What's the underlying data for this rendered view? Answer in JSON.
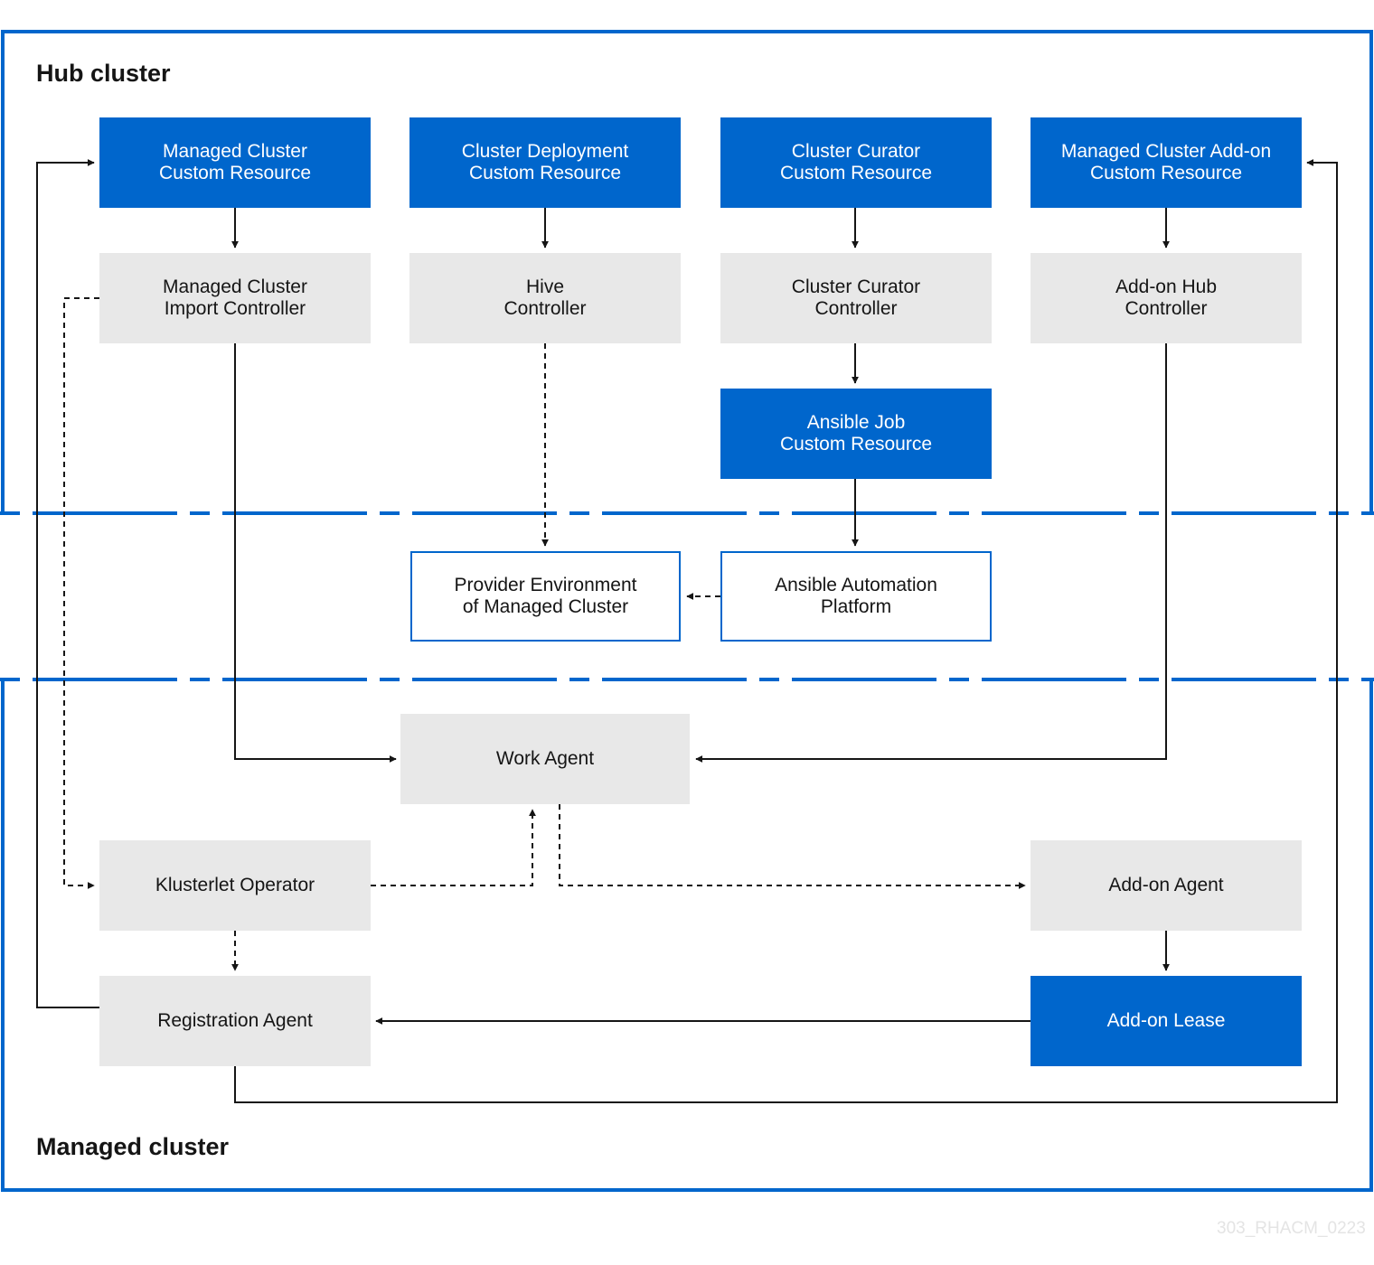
{
  "colors": {
    "accent": "#0066cc",
    "node_gray": "#e8e8e8",
    "line": "#151515",
    "watermark": "#e4e4e4"
  },
  "regions": {
    "hub": {
      "label": "Hub cluster"
    },
    "managed": {
      "label": "Managed cluster"
    }
  },
  "nodes": {
    "managed_cluster_cr": {
      "label": "Managed Cluster\nCustom Resource",
      "style": "blue"
    },
    "cluster_deployment_cr": {
      "label": "Cluster Deployment\nCustom Resource",
      "style": "blue"
    },
    "cluster_curator_cr": {
      "label": "Cluster Curator\nCustom Resource",
      "style": "blue"
    },
    "managed_cluster_addon_cr": {
      "label": "Managed Cluster Add-on\nCustom Resource",
      "style": "blue"
    },
    "import_controller": {
      "label": "Managed Cluster\nImport Controller",
      "style": "gray"
    },
    "hive_controller": {
      "label": "Hive\nController",
      "style": "gray"
    },
    "cluster_curator_controller": {
      "label": "Cluster Curator\nController",
      "style": "gray"
    },
    "addon_hub_controller": {
      "label": "Add-on Hub\nController",
      "style": "gray"
    },
    "ansible_job_cr": {
      "label": "Ansible Job\nCustom Resource",
      "style": "blue"
    },
    "provider_environment": {
      "label": "Provider Environment\nof Managed Cluster",
      "style": "outline"
    },
    "ansible_automation_platform": {
      "label": "Ansible Automation\nPlatform",
      "style": "outline"
    },
    "work_agent": {
      "label": "Work Agent",
      "style": "gray"
    },
    "klusterlet_operator": {
      "label": "Klusterlet Operator",
      "style": "gray"
    },
    "addon_agent": {
      "label": "Add-on Agent",
      "style": "gray"
    },
    "registration_agent": {
      "label": "Registration Agent",
      "style": "gray"
    },
    "addon_lease": {
      "label": "Add-on Lease",
      "style": "blue"
    }
  },
  "edges": [
    {
      "from": "Managed Cluster Custom Resource",
      "to": "Managed Cluster Import Controller",
      "style": "solid"
    },
    {
      "from": "Cluster Deployment Custom Resource",
      "to": "Hive Controller",
      "style": "solid"
    },
    {
      "from": "Cluster Curator Custom Resource",
      "to": "Cluster Curator Controller",
      "style": "solid"
    },
    {
      "from": "Managed Cluster Add-on Custom Resource",
      "to": "Add-on Hub Controller",
      "style": "solid"
    },
    {
      "from": "Cluster Curator Controller",
      "to": "Ansible Job Custom Resource",
      "style": "solid"
    },
    {
      "from": "Ansible Job Custom Resource",
      "to": "Ansible Automation Platform",
      "style": "solid"
    },
    {
      "from": "Hive Controller",
      "to": "Provider Environment of Managed Cluster",
      "style": "dashed"
    },
    {
      "from": "Ansible Automation Platform",
      "to": "Provider Environment of Managed Cluster",
      "style": "dashed"
    },
    {
      "from": "Managed Cluster Import Controller",
      "to": "Work Agent",
      "style": "solid"
    },
    {
      "from": "Add-on Hub Controller",
      "to": "Work Agent",
      "style": "solid"
    },
    {
      "from": "Managed Cluster Import Controller",
      "to": "Klusterlet Operator",
      "style": "dashed"
    },
    {
      "from": "Klusterlet Operator",
      "to": "Work Agent",
      "style": "dashed"
    },
    {
      "from": "Work Agent",
      "to": "Add-on Agent",
      "style": "dashed"
    },
    {
      "from": "Klusterlet Operator",
      "to": "Registration Agent",
      "style": "dashed"
    },
    {
      "from": "Add-on Agent",
      "to": "Add-on Lease",
      "style": "solid"
    },
    {
      "from": "Add-on Lease",
      "to": "Registration Agent",
      "style": "solid"
    },
    {
      "from": "Registration Agent",
      "to": "Managed Cluster Custom Resource",
      "style": "solid"
    },
    {
      "from": "Registration Agent",
      "to": "Managed Cluster Add-on Custom Resource",
      "style": "solid"
    }
  ],
  "watermark": "303_RHACM_0223"
}
